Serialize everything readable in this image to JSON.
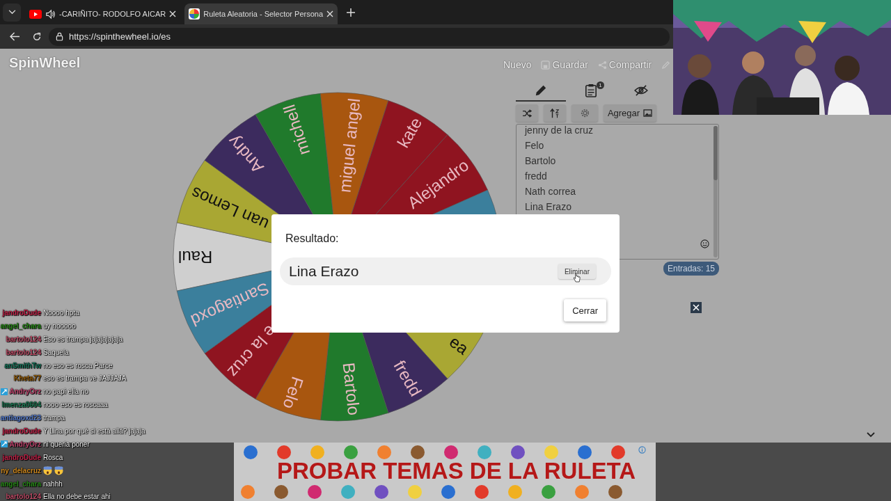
{
  "browser": {
    "tabs": [
      {
        "title": "-CARIÑITO- RODOLFO AICAR",
        "selected": false,
        "audio": true
      },
      {
        "title": "Ruleta Aleatoria - Selector Persona",
        "selected": true,
        "audio": false
      }
    ],
    "url": "https://spinthewheel.io/es"
  },
  "app": {
    "logo": "SpinWheel",
    "menu": [
      {
        "kind": "text",
        "label": "Nuevo"
      },
      {
        "kind": "save",
        "label": "Guardar"
      },
      {
        "kind": "share",
        "label": "Compartir"
      },
      {
        "kind": "edit"
      }
    ],
    "editor_tabs": [
      {
        "kind": "edit",
        "selected": true
      },
      {
        "kind": "results",
        "selected": false,
        "badge": "1"
      },
      {
        "kind": "hide",
        "selected": false
      }
    ],
    "tools": [
      {
        "kind": "shuffle"
      },
      {
        "kind": "sort"
      },
      {
        "kind": "settings"
      },
      {
        "kind": "add-image",
        "label": "Agregar"
      }
    ],
    "entries": [
      "jenny de la cruz",
      "Felo",
      "Bartolo",
      "fredd",
      "Nath correa",
      "Lina Erazo"
    ],
    "entry_count": "Entradas: 15",
    "wheel": {
      "segments": [
        {
          "label": "Raul",
          "color": "#cfcfcf"
        },
        {
          "label": "uan Lemos",
          "color": "#a9a733"
        },
        {
          "label": "Andry",
          "color": "#3c2b5e"
        },
        {
          "label": "michell",
          "color": "#207a2c"
        },
        {
          "label": "miguel angel",
          "color": "#a8560f"
        },
        {
          "label": "kate",
          "color": "#8f1420"
        },
        {
          "label": "Alejandro",
          "color": "#8f1420"
        },
        {
          "color": "#3b7f9c"
        },
        {
          "label": "ea",
          "color": "#a9a733"
        },
        {
          "label": "fredd",
          "color": "#3c2b5e"
        },
        {
          "label": "Bartolo",
          "color": "#207a2c"
        },
        {
          "label": "Felo",
          "color": "#a8560f"
        },
        {
          "label": "e la cruz",
          "color": "#8f1420"
        },
        {
          "label": "Santiagoxd",
          "color": "#3b7f9c"
        }
      ]
    }
  },
  "dialog": {
    "title": "Resultado:",
    "result": "Lina Erazo",
    "remove": "Eliminar",
    "close": "Cerrar"
  },
  "chat": [
    {
      "user": "jandroDude",
      "color": "#c2244a",
      "message": "Noooo hpta"
    },
    {
      "user": "angel_chara",
      "color": "#2a8a1a",
      "message": "uy nooooo"
    },
    {
      "user": "bartolo124",
      "color": "#c0506a",
      "message": "Eso es trampa jajajajajaja"
    },
    {
      "user": "bartolo124",
      "color": "#c0506a",
      "message": "Saquela"
    },
    {
      "user": "anSmithTw",
      "color": "#17745a",
      "message": "no eso es rosca Parce"
    },
    {
      "user": "Kheta77",
      "color": "#98600c",
      "message": "eso es trampa ve JAJJAJA"
    },
    {
      "user": "AndryOrz",
      "color": "#c04870",
      "badge": true,
      "message": "no papi ella no"
    },
    {
      "user": "lmenza0604",
      "color": "#1f7a55",
      "message": "nooo eso es roscaaa"
    },
    {
      "user": "antiagoxd23",
      "color": "#5a7fcf",
      "message": "trampa"
    },
    {
      "user": "jandroDude",
      "color": "#c2244a",
      "message": "Y Lina por qué si está allá? jajaja"
    },
    {
      "user": "AndryOrz",
      "color": "#c04870",
      "badge": true,
      "message": "ni queria poner"
    },
    {
      "user": "jandroDude",
      "color": "#c2244a",
      "message": "Rosca"
    },
    {
      "user": "ny_delacruz",
      "color": "#d08a20",
      "kind": "emoji"
    },
    {
      "user": "angel_chara",
      "color": "#2a8a1a",
      "message": "nahhh"
    },
    {
      "user": "bartolo124",
      "color": "#c0506a",
      "message": "Ella no debe estar ahi"
    }
  ],
  "ad": {
    "headline": "PROBAR TEMAS DE LA RULETA"
  }
}
